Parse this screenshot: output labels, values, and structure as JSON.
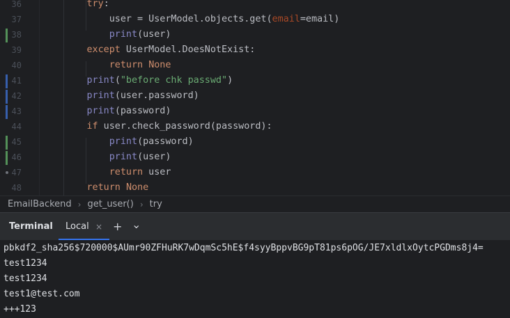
{
  "editor": {
    "lines": [
      {
        "num": "36",
        "parts": [
          {
            "t": "        "
          },
          {
            "t": "try",
            "c": "kw"
          },
          {
            "t": ":"
          }
        ]
      },
      {
        "num": "37",
        "parts": [
          {
            "t": "            user = UserModel.objects.get("
          },
          {
            "t": "email",
            "c": "param"
          },
          {
            "t": "=email)"
          }
        ]
      },
      {
        "num": "38",
        "parts": [
          {
            "t": "            "
          },
          {
            "t": "print",
            "c": "builtin"
          },
          {
            "t": "(user)"
          }
        ]
      },
      {
        "num": "39",
        "parts": [
          {
            "t": "        "
          },
          {
            "t": "except",
            "c": "kw"
          },
          {
            "t": " UserModel.DoesNotExist:"
          }
        ]
      },
      {
        "num": "40",
        "parts": [
          {
            "t": "            "
          },
          {
            "t": "return",
            "c": "kw"
          },
          {
            "t": " "
          },
          {
            "t": "None",
            "c": "kw"
          }
        ]
      },
      {
        "num": "41",
        "parts": [
          {
            "t": "        "
          },
          {
            "t": "print",
            "c": "builtin"
          },
          {
            "t": "("
          },
          {
            "t": "\"before chk passwd\"",
            "c": "str"
          },
          {
            "t": ")"
          }
        ]
      },
      {
        "num": "42",
        "parts": [
          {
            "t": "        "
          },
          {
            "t": "print",
            "c": "builtin"
          },
          {
            "t": "(user.password)"
          }
        ]
      },
      {
        "num": "43",
        "parts": [
          {
            "t": "        "
          },
          {
            "t": "print",
            "c": "builtin"
          },
          {
            "t": "(password)"
          }
        ]
      },
      {
        "num": "44",
        "parts": [
          {
            "t": "        "
          },
          {
            "t": "if",
            "c": "kw"
          },
          {
            "t": " user.check_password(password):"
          }
        ]
      },
      {
        "num": "45",
        "parts": [
          {
            "t": "            "
          },
          {
            "t": "print",
            "c": "builtin"
          },
          {
            "t": "(password)"
          }
        ]
      },
      {
        "num": "46",
        "parts": [
          {
            "t": "            "
          },
          {
            "t": "print",
            "c": "builtin"
          },
          {
            "t": "(user)"
          }
        ]
      },
      {
        "num": "47",
        "parts": [
          {
            "t": "            "
          },
          {
            "t": "return",
            "c": "kw"
          },
          {
            "t": " user"
          }
        ]
      },
      {
        "num": "48",
        "parts": [
          {
            "t": "        "
          },
          {
            "t": "return",
            "c": "kw"
          },
          {
            "t": " "
          },
          {
            "t": "None",
            "c": "kw"
          }
        ]
      }
    ],
    "colors": {
      "added": "#549159",
      "modified": "#375fad"
    }
  },
  "breadcrumb": {
    "items": [
      "EmailBackend",
      "get_user()",
      "try"
    ]
  },
  "terminal": {
    "title": "Terminal",
    "tab_label": "Local",
    "close_glyph": "×",
    "add_glyph": "+",
    "dropdown_glyph": "⌄",
    "output": [
      "pbkdf2_sha256$720000$AUmr90ZFHuRK7wDqmSc5hE$f4syyBppvBG9pT81ps6pOG/JE7xldlxOytcPGDms8j4=",
      "test1234",
      "test1234",
      "test1@test.com",
      "+++123"
    ]
  }
}
